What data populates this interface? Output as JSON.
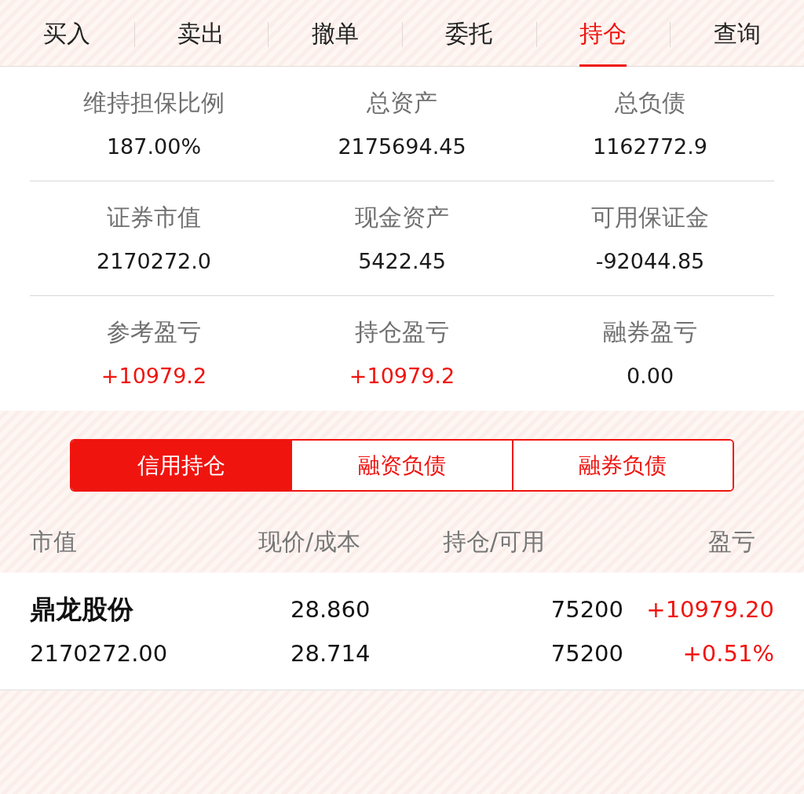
{
  "tabs": [
    {
      "label": "买入",
      "selected": false
    },
    {
      "label": "卖出",
      "selected": false
    },
    {
      "label": "撤单",
      "selected": false
    },
    {
      "label": "委托",
      "selected": false
    },
    {
      "label": "持仓",
      "selected": true
    },
    {
      "label": "查询",
      "selected": false
    }
  ],
  "summary": [
    [
      {
        "label": "维持担保比例",
        "value": "187.00%",
        "color": "#1a1a1a"
      },
      {
        "label": "总资产",
        "value": "2175694.45",
        "color": "#1a1a1a"
      },
      {
        "label": "总负债",
        "value": "1162772.9",
        "color": "#1a1a1a"
      }
    ],
    [
      {
        "label": "证券市值",
        "value": "2170272.0",
        "color": "#1a1a1a"
      },
      {
        "label": "现金资产",
        "value": "5422.45",
        "color": "#1a1a1a"
      },
      {
        "label": "可用保证金",
        "value": "-92044.85",
        "color": "#1a1a1a"
      }
    ],
    [
      {
        "label": "参考盈亏",
        "value": "+10979.2",
        "color": "#f0140f"
      },
      {
        "label": "持仓盈亏",
        "value": "+10979.2",
        "color": "#f0140f"
      },
      {
        "label": "融券盈亏",
        "value": "0.00",
        "color": "#1a1a1a"
      }
    ]
  ],
  "segments": [
    {
      "label": "信用持仓",
      "selected": true
    },
    {
      "label": "融资负债",
      "selected": false
    },
    {
      "label": "融券负债",
      "selected": false
    }
  ],
  "table": {
    "columns": [
      "市值",
      "现价/成本",
      "持仓/可用",
      "盈亏"
    ],
    "rows": [
      {
        "name": "鼎龙股份",
        "market_value": "2170272.00",
        "price": "28.860",
        "cost": "28.714",
        "holding": "75200",
        "available": "75200",
        "pnl": "+10979.20",
        "pnl_pct": "+0.51%",
        "color": "#f0140f"
      }
    ]
  }
}
